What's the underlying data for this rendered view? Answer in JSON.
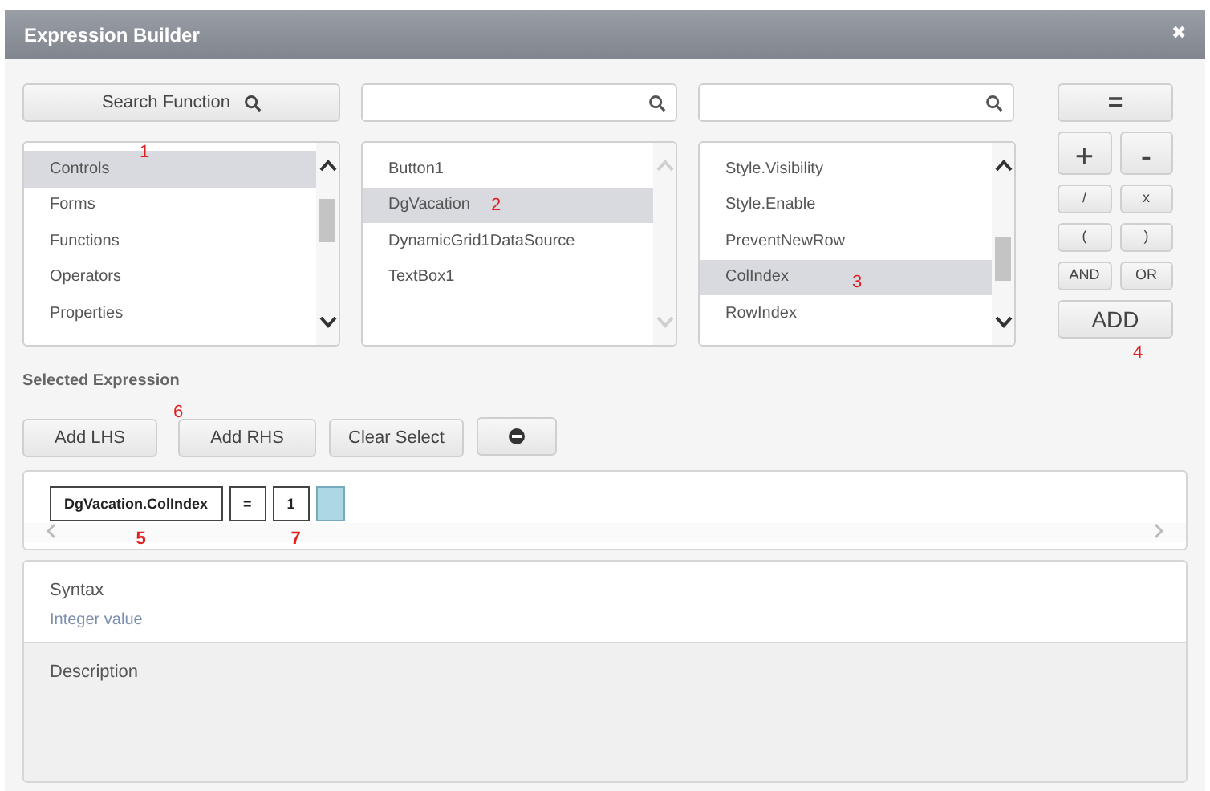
{
  "window": {
    "title": "Expression Builder",
    "close": "✖"
  },
  "search_function": {
    "label": "Search Function"
  },
  "search_fields": [
    {
      "kind": "search"
    },
    {
      "kind": "search"
    }
  ],
  "lists": [
    {
      "items": [
        {
          "label": "Controls",
          "selected": true,
          "callout": "1"
        },
        {
          "label": "Forms",
          "selected": false
        },
        {
          "label": "Functions",
          "selected": false
        },
        {
          "label": "Operators",
          "selected": false
        },
        {
          "label": "Properties",
          "selected": false
        }
      ],
      "scroll_disabled": false
    },
    {
      "items": [
        {
          "label": "Button1",
          "selected": false
        },
        {
          "label": "DgVacation",
          "selected": true,
          "callout": "2"
        },
        {
          "label": "DynamicGrid1DataSource",
          "selected": false
        },
        {
          "label": "TextBox1",
          "selected": false
        }
      ],
      "scroll_disabled": true
    },
    {
      "items": [
        {
          "label": "Style.Visibility",
          "selected": false
        },
        {
          "label": "Style.Enable",
          "selected": false
        },
        {
          "label": "PreventNewRow",
          "selected": false
        },
        {
          "label": "ColIndex",
          "selected": true,
          "callout": "3"
        },
        {
          "label": "RowIndex",
          "selected": false
        }
      ],
      "scroll_disabled": false
    }
  ],
  "operators": {
    "equals": "=",
    "rows": [
      [
        "+",
        "-"
      ],
      [
        "/",
        "x"
      ],
      [
        "(",
        ")"
      ],
      [
        "AND",
        "OR"
      ]
    ],
    "add": {
      "label": "ADD",
      "callout": "4"
    }
  },
  "selected_expression": {
    "title": "Selected Expression",
    "buttons": [
      {
        "label": "Add LHS"
      },
      {
        "label": "Add RHS",
        "callout": "6"
      },
      {
        "label": "Clear Select"
      }
    ],
    "tokens": [
      {
        "text": "DgVacation.ColIndex",
        "kind": "text",
        "callout": "5"
      },
      {
        "text": "=",
        "kind": "text"
      },
      {
        "text": "1",
        "kind": "text",
        "callout": "7"
      },
      {
        "kind": "empty"
      }
    ]
  },
  "syntax": {
    "title": "Syntax",
    "value": "Integer value"
  },
  "description": {
    "title": "Description"
  }
}
